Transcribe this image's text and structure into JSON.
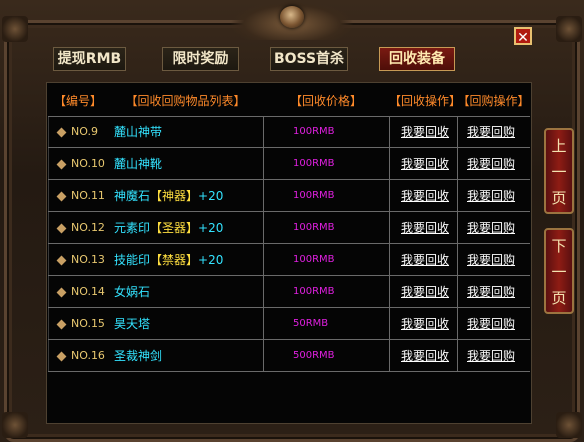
{
  "window": {
    "close_symbol": "✕"
  },
  "tabs": [
    {
      "label": "提现RMB",
      "active": false
    },
    {
      "label": "限时奖励",
      "active": false
    },
    {
      "label": "BOSS首杀",
      "active": false
    },
    {
      "label": "回收装备",
      "active": true
    }
  ],
  "table": {
    "headers": [
      "【编号】",
      "【回收回购物品列表】",
      "【回收价格】",
      "【回收操作】",
      "【回购操作】"
    ],
    "rows": [
      {
        "id": "NO.9",
        "name": "麓山神带",
        "tag": "",
        "suffix": "",
        "price": "100RMB",
        "recycle": "我要回收",
        "buyback": "我要回购"
      },
      {
        "id": "NO.10",
        "name": "麓山神靴",
        "tag": "",
        "suffix": "",
        "price": "100RMB",
        "recycle": "我要回收",
        "buyback": "我要回购"
      },
      {
        "id": "NO.11",
        "name": "神魔石",
        "tag": "【神器】",
        "suffix": "+20",
        "price": "100RMB",
        "recycle": "我要回收",
        "buyback": "我要回购"
      },
      {
        "id": "NO.12",
        "name": "元素印",
        "tag": "【圣器】",
        "suffix": "+20",
        "price": "100RMB",
        "recycle": "我要回收",
        "buyback": "我要回购"
      },
      {
        "id": "NO.13",
        "name": "技能印",
        "tag": "【禁器】",
        "suffix": "+20",
        "price": "100RMB",
        "recycle": "我要回收",
        "buyback": "我要回购"
      },
      {
        "id": "NO.14",
        "name": "女娲石",
        "tag": "",
        "suffix": "",
        "price": "100RMB",
        "recycle": "我要回收",
        "buyback": "我要回购"
      },
      {
        "id": "NO.15",
        "name": "昊天塔",
        "tag": "",
        "suffix": "",
        "price": "50RMB",
        "recycle": "我要回收",
        "buyback": "我要回购"
      },
      {
        "id": "NO.16",
        "name": "圣裁神剑",
        "tag": "",
        "suffix": "",
        "price": "500RMB",
        "recycle": "我要回收",
        "buyback": "我要回购"
      }
    ]
  },
  "pager": {
    "prev": [
      "上",
      "一",
      "页"
    ],
    "next": [
      "下",
      "一",
      "页"
    ]
  }
}
